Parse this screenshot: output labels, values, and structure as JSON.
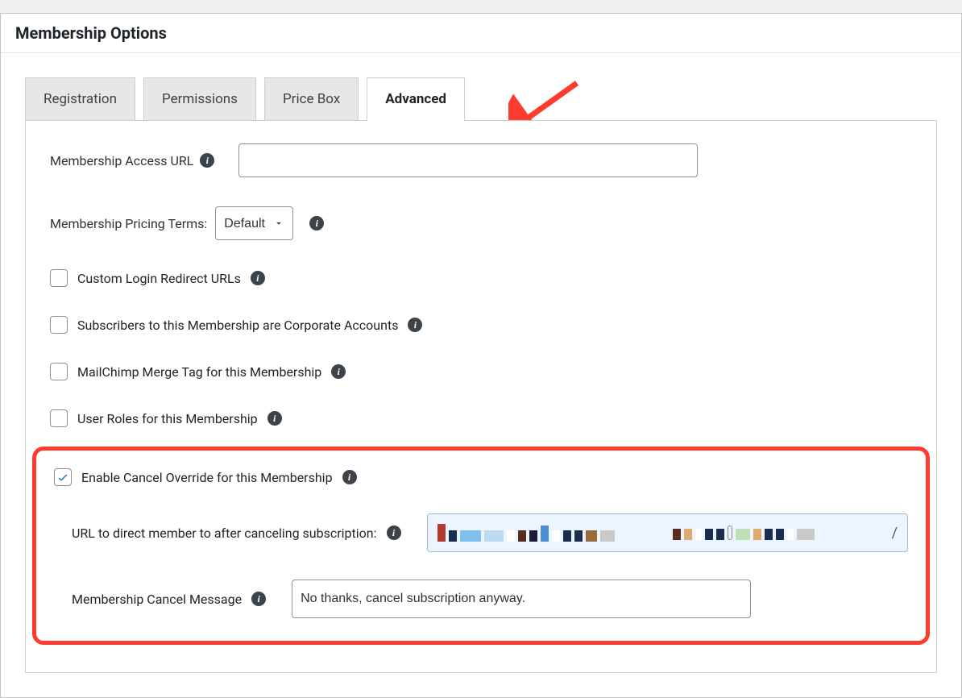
{
  "panel": {
    "title": "Membership Options"
  },
  "tabs": {
    "registration": "Registration",
    "permissions": "Permissions",
    "price_box": "Price Box",
    "advanced": "Advanced"
  },
  "fields": {
    "access_url_label": "Membership Access URL",
    "access_url_value": "",
    "pricing_terms_label": "Membership Pricing Terms:",
    "pricing_terms_value": "Default",
    "custom_login_redirect": "Custom Login Redirect URLs",
    "corporate_accounts": "Subscribers to this Membership are Corporate Accounts",
    "mailchimp_merge_tag": "MailChimp Merge Tag for this Membership",
    "user_roles": "User Roles for this Membership",
    "enable_cancel_override": "Enable Cancel Override for this Membership",
    "cancel_url_label": "URL to direct member to after canceling subscription:",
    "cancel_url_slash": "/",
    "cancel_message_label": "Membership Cancel Message",
    "cancel_message_value": "No thanks, cancel subscription anyway."
  },
  "checkbox_state": {
    "custom_login_redirect": false,
    "corporate_accounts": false,
    "mailchimp_merge_tag": false,
    "user_roles": false,
    "enable_cancel_override": true
  }
}
